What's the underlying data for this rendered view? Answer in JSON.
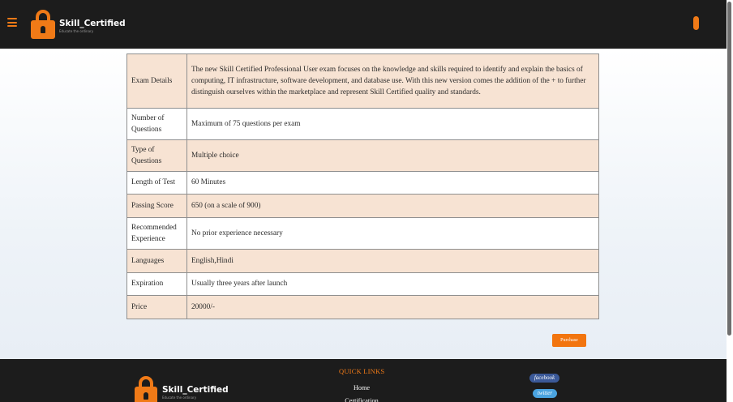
{
  "header": {
    "brand_name": "Skill_Certified",
    "brand_tagline": "Educate the ordinary"
  },
  "exam_table": [
    {
      "label": "Exam Details",
      "value": "The new Skill Certified Professional User exam focuses on the knowledge and skills required to identify and explain the basics of computing, IT infrastructure, software development, and database use. With this new version comes the addition of the + to further distinguish ourselves within the marketplace and represent Skill Certified quality and standards."
    },
    {
      "label": "Number of Questions",
      "value": "Maximum of 75 questions per exam"
    },
    {
      "label": "Type of Questions",
      "value": "Multiple choice"
    },
    {
      "label": "Length of Test",
      "value": "60 Minutes"
    },
    {
      "label": "Passing Score",
      "value": "650 (on a scale of 900)"
    },
    {
      "label": "Recommended Experience",
      "value": "No prior experience necessary"
    },
    {
      "label": "Languages",
      "value": "English,Hindi"
    },
    {
      "label": "Expiration",
      "value": "Usually three years after launch"
    },
    {
      "label": "Price",
      "value": "20000/-"
    }
  ],
  "purchase_label": "Purchase",
  "footer": {
    "brand_name": "Skill_Certified",
    "brand_tagline": "Educate the ordinary",
    "quick_links_title": "QUICK LINKS",
    "quick_links": [
      "Home",
      "Certification"
    ],
    "social": {
      "facebook": "facebook",
      "twitter": "twitter"
    }
  },
  "colors": {
    "accent": "#f07a17",
    "dark_bar": "#1c1c1c",
    "row_tint": "#f7e3d3"
  }
}
